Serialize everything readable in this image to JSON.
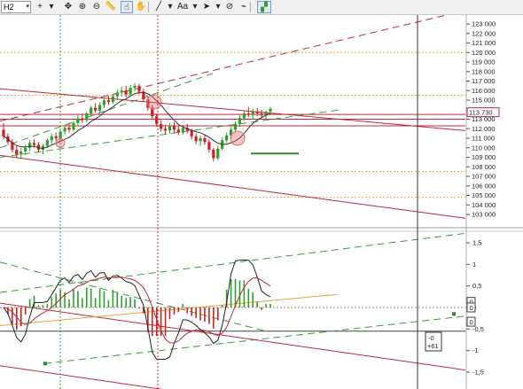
{
  "toolbar": {
    "timeframe": "H2",
    "items": [
      {
        "icon": "crosshair-plus-icon",
        "glyph": "+"
      },
      {
        "icon": "dropdown-arrow-icon",
        "glyph": "▾"
      },
      {
        "icon": "move-arrows-icon",
        "glyph": "✥"
      },
      {
        "icon": "zoom-in-icon",
        "glyph": "⊕"
      },
      {
        "icon": "zoom-out-icon",
        "glyph": "⊖"
      },
      {
        "icon": "ruler-icon",
        "glyph": "📏"
      },
      {
        "icon": "cursor-hand-icon",
        "glyph": "☝"
      },
      {
        "icon": "pan-hand-icon",
        "glyph": "✋"
      },
      {
        "icon": "line-tool-icon",
        "glyph": "╱"
      },
      {
        "icon": "dropdown-arrow-icon",
        "glyph": "▾"
      },
      {
        "icon": "text-tool-icon",
        "glyph": "Aa"
      },
      {
        "icon": "dropdown-arrow-icon",
        "glyph": "▾"
      },
      {
        "icon": "pointer-tool-icon",
        "glyph": "➤"
      },
      {
        "icon": "dropdown-arrow-icon",
        "glyph": "▾"
      },
      {
        "icon": "hide-drawings-icon",
        "glyph": "⊘"
      },
      {
        "icon": "magnet-icon",
        "glyph": "⌁"
      },
      {
        "icon": "indicator-icon",
        "glyph": "▞"
      }
    ]
  },
  "price_axis": {
    "ticks": [
      "123 000",
      "122 000",
      "121 000",
      "120 000",
      "119 000",
      "118 000",
      "117 000",
      "116 000",
      "115 000",
      "114 000",
      "113 000",
      "112 000",
      "111 000",
      "110 000",
      "109 000",
      "108 000",
      "107 000",
      "106 000",
      "105 000",
      "104 000",
      "103 000"
    ],
    "current_price": "113 730"
  },
  "indicator_axis": {
    "ticks": [
      "1,5",
      "1",
      "0,5",
      "0",
      "-0,5",
      "-1",
      "-1,5"
    ],
    "markers": [
      "0",
      "0",
      "0"
    ]
  },
  "indicator_readout": {
    "line1": "-0",
    "line2": "+61"
  },
  "colors": {
    "up": "#2e9e2e",
    "down": "#d02020",
    "trend_red": "#c0283a",
    "trend_green": "#3a9a3a",
    "level_orange": "#e8a23a",
    "ma": "#333333"
  },
  "chart_data": {
    "type": "candlestick",
    "timeframe": "H2",
    "ohlc": [
      [
        111.9,
        112.6,
        110.9,
        111.2
      ],
      [
        111.2,
        111.5,
        110.3,
        110.6
      ],
      [
        110.6,
        110.9,
        109.5,
        109.8
      ],
      [
        109.8,
        110.2,
        109.0,
        109.3
      ],
      [
        109.3,
        110.0,
        108.9,
        109.6
      ],
      [
        109.6,
        110.3,
        109.2,
        110.0
      ],
      [
        110.0,
        110.8,
        109.7,
        110.5
      ],
      [
        110.5,
        110.9,
        110.0,
        110.3
      ],
      [
        110.3,
        110.6,
        109.5,
        109.8
      ],
      [
        109.8,
        110.4,
        109.3,
        110.2
      ],
      [
        110.2,
        111.0,
        110.0,
        110.8
      ],
      [
        110.8,
        111.5,
        110.4,
        111.2
      ],
      [
        111.2,
        111.6,
        110.7,
        111.0
      ],
      [
        111.0,
        111.9,
        110.8,
        111.7
      ],
      [
        111.7,
        112.4,
        111.4,
        112.1
      ],
      [
        112.1,
        112.6,
        111.6,
        111.9
      ],
      [
        111.9,
        112.8,
        111.7,
        112.6
      ],
      [
        112.6,
        113.4,
        112.3,
        113.1
      ],
      [
        113.1,
        113.6,
        112.6,
        112.9
      ],
      [
        112.9,
        113.8,
        112.7,
        113.6
      ],
      [
        113.6,
        114.4,
        113.3,
        114.2
      ],
      [
        114.2,
        114.7,
        113.7,
        113.9
      ],
      [
        113.9,
        114.8,
        113.6,
        114.5
      ],
      [
        114.5,
        115.2,
        114.2,
        115.0
      ],
      [
        115.0,
        115.5,
        114.5,
        114.8
      ],
      [
        114.8,
        115.6,
        114.6,
        115.4
      ],
      [
        115.4,
        116.1,
        115.0,
        115.8
      ],
      [
        115.8,
        116.4,
        115.4,
        116.0
      ],
      [
        116.0,
        116.5,
        115.3,
        115.6
      ],
      [
        115.6,
        116.6,
        115.5,
        116.3
      ],
      [
        116.3,
        116.8,
        115.9,
        116.5
      ],
      [
        116.5,
        116.7,
        115.6,
        115.9
      ],
      [
        115.9,
        116.2,
        114.8,
        115.1
      ],
      [
        115.1,
        115.4,
        113.9,
        114.2
      ],
      [
        114.2,
        114.5,
        113.0,
        113.3
      ],
      [
        113.3,
        113.6,
        112.2,
        112.5
      ],
      [
        112.5,
        112.9,
        111.7,
        112.0
      ],
      [
        112.0,
        112.4,
        111.4,
        111.8
      ],
      [
        111.8,
        112.6,
        111.5,
        112.3
      ],
      [
        112.3,
        112.7,
        111.6,
        111.9
      ],
      [
        111.9,
        112.3,
        111.3,
        111.6
      ],
      [
        111.6,
        112.4,
        111.4,
        112.1
      ],
      [
        112.1,
        112.5,
        111.5,
        111.8
      ],
      [
        111.8,
        112.0,
        110.9,
        111.2
      ],
      [
        111.2,
        111.5,
        110.4,
        110.7
      ],
      [
        110.7,
        111.3,
        110.2,
        111.0
      ],
      [
        111.0,
        111.4,
        110.3,
        110.6
      ],
      [
        110.6,
        110.9,
        109.5,
        109.8
      ],
      [
        109.8,
        110.0,
        108.6,
        108.9
      ],
      [
        108.9,
        110.2,
        108.7,
        109.9
      ],
      [
        109.9,
        111.1,
        109.7,
        110.8
      ],
      [
        110.8,
        111.6,
        110.5,
        111.3
      ],
      [
        111.3,
        112.2,
        111.0,
        111.9
      ],
      [
        111.9,
        112.8,
        111.6,
        112.5
      ],
      [
        112.5,
        113.4,
        112.2,
        113.1
      ],
      [
        113.1,
        113.9,
        112.8,
        113.6
      ],
      [
        113.6,
        114.3,
        113.2,
        113.5
      ],
      [
        113.5,
        114.1,
        113.0,
        113.8
      ],
      [
        113.8,
        114.2,
        113.3,
        113.6
      ],
      [
        113.6,
        114.0,
        113.1,
        113.4
      ],
      [
        113.4,
        113.9,
        113.0,
        113.8
      ],
      [
        113.8,
        114.3,
        113.6,
        114.1
      ]
    ],
    "price_range": [
      102.5,
      123.8
    ],
    "indicator_range": [
      -1.85,
      1.72
    ]
  }
}
